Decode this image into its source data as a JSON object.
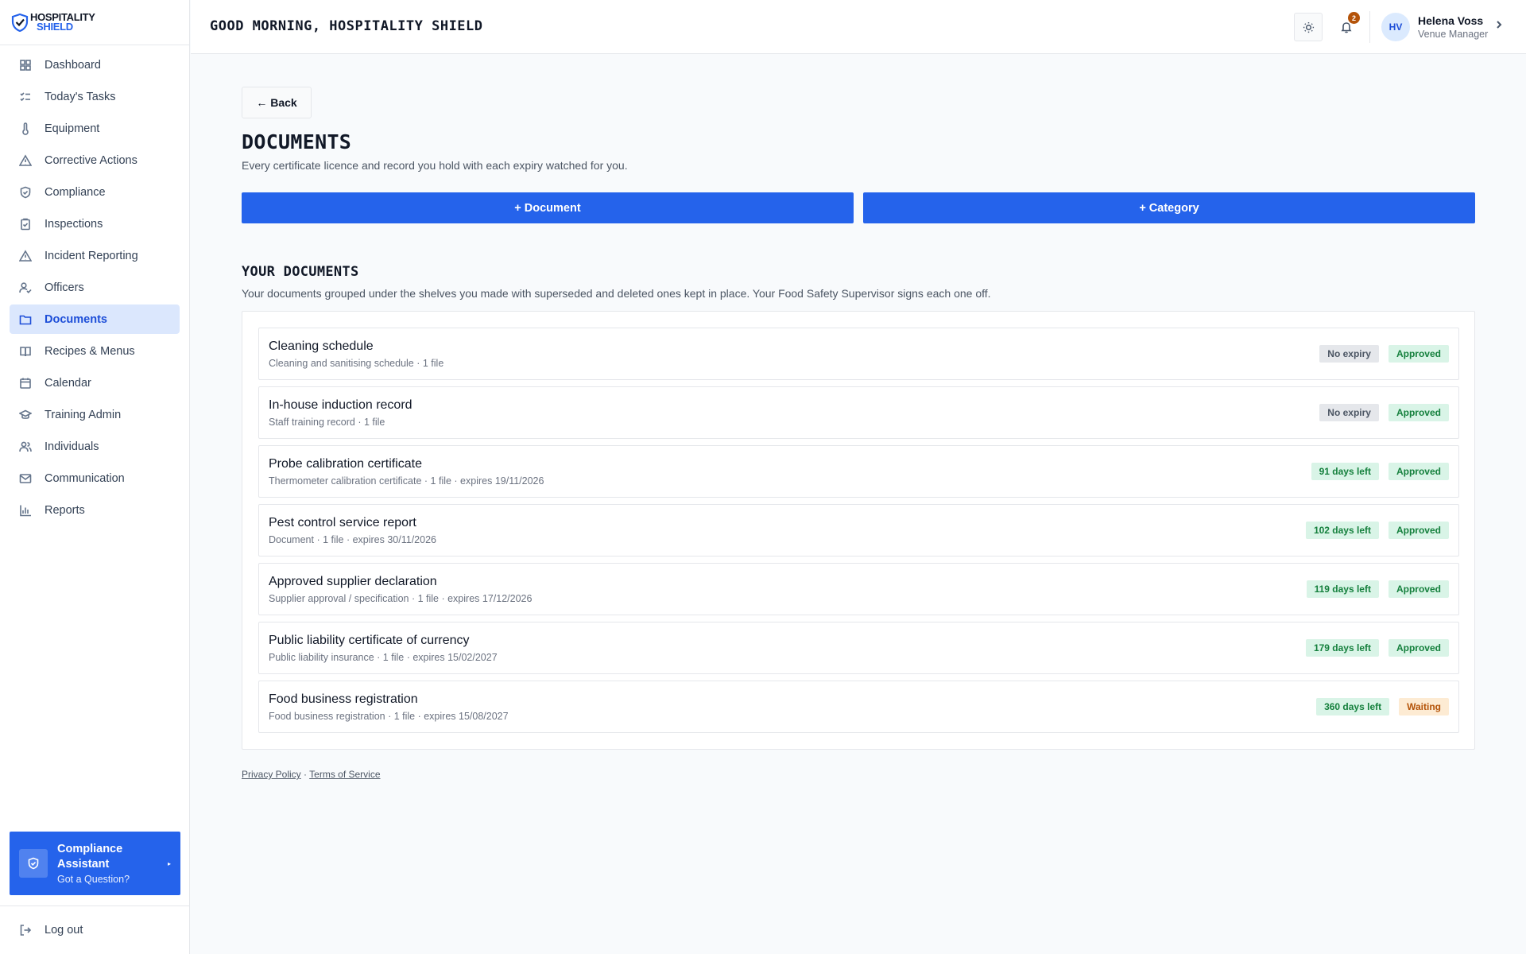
{
  "brand": {
    "line1": "HOSPITALITY",
    "line2": "SHIELD"
  },
  "header": {
    "greeting": "GOOD MORNING, HOSPITALITY SHIELD",
    "notification_count": "2",
    "user": {
      "initials": "HV",
      "name": "Helena Voss",
      "role": "Venue Manager"
    }
  },
  "sidebar": {
    "items": [
      {
        "label": "Dashboard",
        "icon": "grid-icon"
      },
      {
        "label": "Today's Tasks",
        "icon": "list-check-icon"
      },
      {
        "label": "Equipment",
        "icon": "thermometer-icon"
      },
      {
        "label": "Corrective Actions",
        "icon": "warning-icon"
      },
      {
        "label": "Compliance",
        "icon": "shield-check-icon"
      },
      {
        "label": "Inspections",
        "icon": "clipboard-check-icon"
      },
      {
        "label": "Incident Reporting",
        "icon": "warning-icon"
      },
      {
        "label": "Officers",
        "icon": "user-check-icon"
      },
      {
        "label": "Documents",
        "icon": "folder-icon",
        "active": true
      },
      {
        "label": "Recipes & Menus",
        "icon": "book-icon"
      },
      {
        "label": "Calendar",
        "icon": "calendar-icon"
      },
      {
        "label": "Training Admin",
        "icon": "graduation-cap-icon"
      },
      {
        "label": "Individuals",
        "icon": "users-icon"
      },
      {
        "label": "Communication",
        "icon": "mail-icon"
      },
      {
        "label": "Reports",
        "icon": "bar-chart-icon"
      }
    ],
    "assistant": {
      "title": "Compliance Assistant",
      "subtitle": "Got a Question?"
    },
    "logout": "Log out"
  },
  "page": {
    "back_label": "← Back",
    "title": "DOCUMENTS",
    "subtitle": "Every certificate licence and record you hold with each expiry watched for you.",
    "add_document": "+ Document",
    "add_category": "+ Category",
    "section_title": "YOUR DOCUMENTS",
    "section_subtitle": "Your documents grouped under the shelves you made with superseded and deleted ones kept in place. Your Food Safety Supervisor signs each one off."
  },
  "documents": [
    {
      "title": "Cleaning schedule",
      "meta": "Cleaning and sanitising schedule · 1 file",
      "expiry": "No expiry",
      "expiry_style": "grey",
      "status": "Approved",
      "status_style": "green"
    },
    {
      "title": "In-house induction record",
      "meta": "Staff training record · 1 file",
      "expiry": "No expiry",
      "expiry_style": "grey",
      "status": "Approved",
      "status_style": "green"
    },
    {
      "title": "Probe calibration certificate",
      "meta": "Thermometer calibration certificate · 1 file · expires 19/11/2026",
      "expiry": "91 days left",
      "expiry_style": "green",
      "status": "Approved",
      "status_style": "green"
    },
    {
      "title": "Pest control service report",
      "meta": "Document · 1 file · expires 30/11/2026",
      "expiry": "102 days left",
      "expiry_style": "green",
      "status": "Approved",
      "status_style": "green"
    },
    {
      "title": "Approved supplier declaration",
      "meta": "Supplier approval / specification · 1 file · expires 17/12/2026",
      "expiry": "119 days left",
      "expiry_style": "green",
      "status": "Approved",
      "status_style": "green"
    },
    {
      "title": "Public liability certificate of currency",
      "meta": "Public liability insurance · 1 file · expires 15/02/2027",
      "expiry": "179 days left",
      "expiry_style": "green",
      "status": "Approved",
      "status_style": "green"
    },
    {
      "title": "Food business registration",
      "meta": "Food business registration · 1 file · expires 15/08/2027",
      "expiry": "360 days left",
      "expiry_style": "green",
      "status": "Waiting",
      "status_style": "amber"
    }
  ],
  "footer": {
    "privacy": "Privacy Policy",
    "separator": "·",
    "terms": "Terms of Service"
  },
  "colors": {
    "accent": "#2563eb",
    "active_nav_bg": "#dbe7fd",
    "approved": "#15803d",
    "waiting": "#b45309"
  }
}
